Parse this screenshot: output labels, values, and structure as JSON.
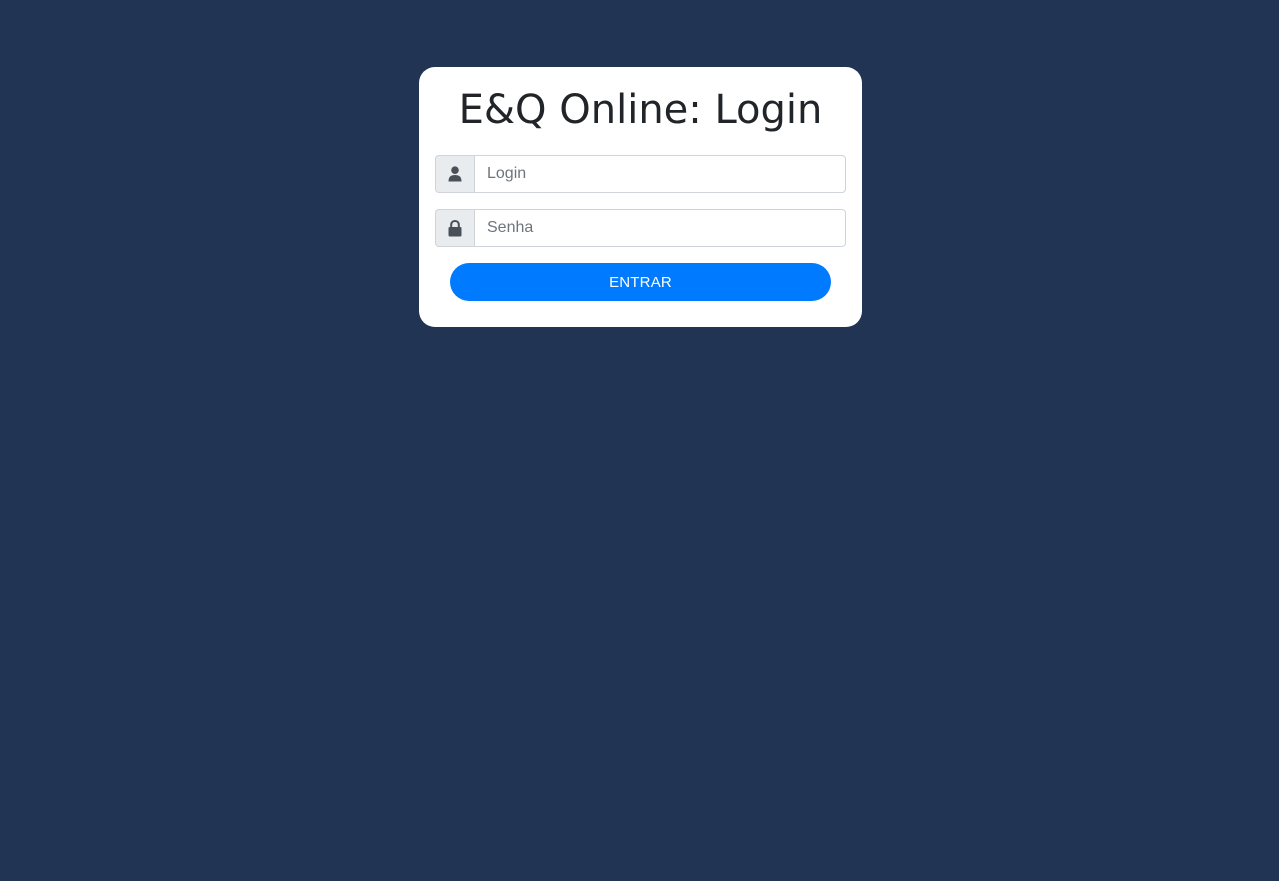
{
  "login_card": {
    "title": "E&Q Online: Login",
    "login_field": {
      "placeholder": "Login",
      "value": "",
      "icon": "user-icon"
    },
    "password_field": {
      "placeholder": "Senha",
      "value": "",
      "icon": "lock-icon"
    },
    "submit_label": "ENTRAR"
  },
  "colors": {
    "background": "#213454",
    "card": "#ffffff",
    "button": "#007bff",
    "addon": "#e9ecef",
    "icon": "#495057"
  }
}
